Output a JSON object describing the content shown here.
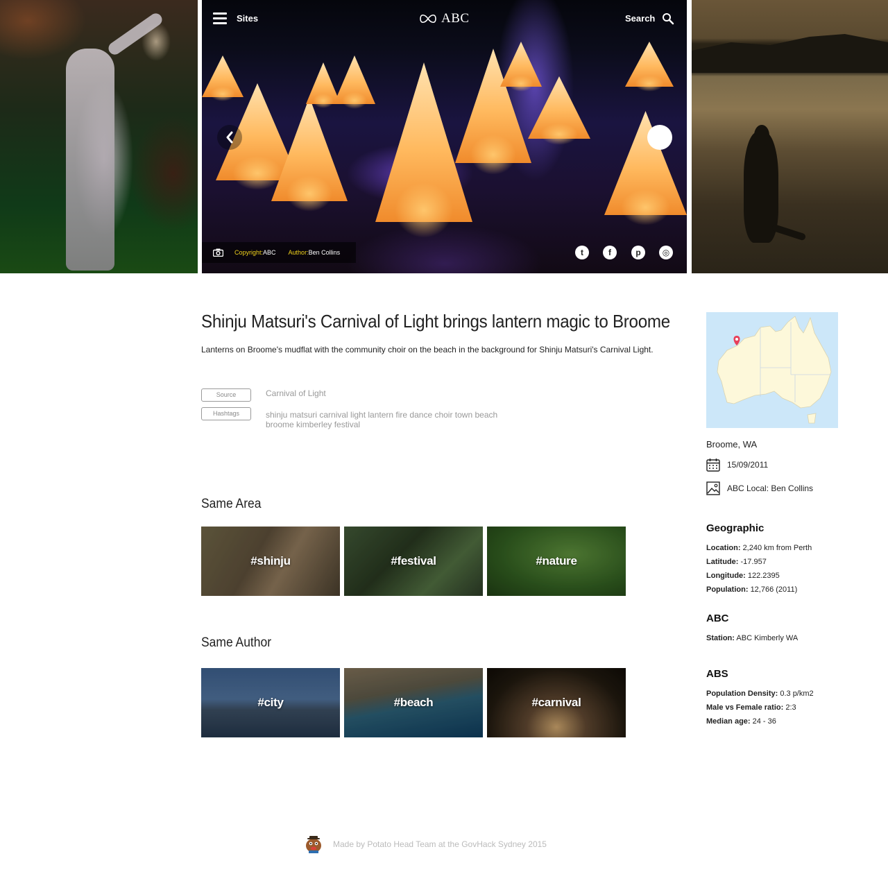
{
  "header": {
    "sites_label": "Sites",
    "logo_text": "ABC",
    "search_label": "Search"
  },
  "hero": {
    "copyright_key": "Copyright:",
    "copyright_value": "ABC",
    "author_key": "Author:",
    "author_value": "Ben Collins",
    "share": [
      {
        "icon": "twitter-icon",
        "glyph": "t"
      },
      {
        "icon": "facebook-icon",
        "glyph": "f"
      },
      {
        "icon": "pinterest-icon",
        "glyph": "p"
      },
      {
        "icon": "instagram-icon",
        "glyph": "◎"
      }
    ]
  },
  "article": {
    "title": "Shinju Matsuri's Carnival of Light brings lantern magic to Broome",
    "lede": "Lanterns on Broome's mudflat with the community choir on the beach in the background for Shinju Matsuri's Carnival Light.",
    "source_label": "Source",
    "source_value": "Carnival of Light",
    "hashtags_label": "Hashtags",
    "hashtags_value": "shinju matsuri carnival light lantern fire dance choir town beach broome kimberley festival"
  },
  "same_area": {
    "heading": "Same Area",
    "tiles": [
      "#shinju",
      "#festival",
      "#nature"
    ]
  },
  "same_author": {
    "heading": "Same Author",
    "tiles": [
      "#city",
      "#beach",
      "#carnival"
    ]
  },
  "sidebar": {
    "place": "Broome, WA",
    "date": "15/09/2011",
    "credit": "ABC Local: Ben Collins",
    "geographic": {
      "heading": "Geographic",
      "location_k": "Location:",
      "location_v": "2,240 km from Perth",
      "latitude_k": "Latitude:",
      "latitude_v": "-17.957",
      "longitude_k": "Longitude:",
      "longitude_v": "122.2395",
      "population_k": "Population:",
      "population_v": "12,766 (2011)"
    },
    "abc": {
      "heading": "ABC",
      "station_k": "Station:",
      "station_v": "ABC Kimberly WA"
    },
    "abs": {
      "heading": "ABS",
      "density_k": "Population Density:",
      "density_v": "0.3 p/km2",
      "ratio_k": "Male vs Female ratio:",
      "ratio_v": "2:3",
      "age_k": "Median age:",
      "age_v": "24 - 36"
    }
  },
  "footer": {
    "text": "Made by Potato Head Team at the GovHack Sydney 2015"
  },
  "colors": {
    "caption_key": "#f1d21b",
    "map_water": "#cce7f9",
    "map_land": "#fdf8da",
    "map_pin": "#e8405a"
  }
}
